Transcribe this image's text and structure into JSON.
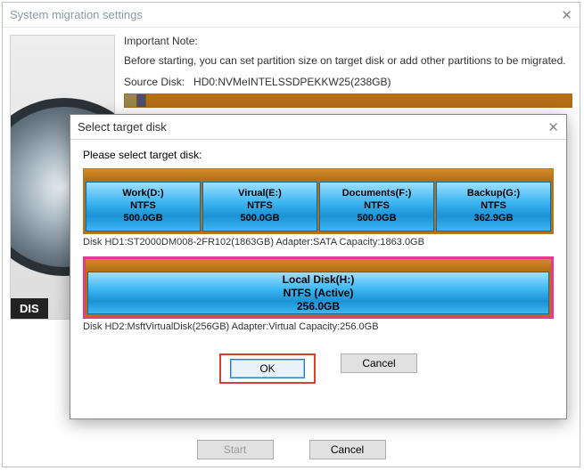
{
  "parent": {
    "title": "System migration settings",
    "illust_label": "DIS",
    "note_title": "Important Note:",
    "note_text": "Before starting, you can set partition size on target disk or add other partitions to be migrated.",
    "source_label": "Source Disk:",
    "source_value": "HD0:NVMeINTELSSDPEKKW25(238GB)",
    "start_label": "Start",
    "cancel_label": "Cancel"
  },
  "modal": {
    "title": "Select target disk",
    "prompt": "Please select target disk:",
    "disk1": {
      "parts": [
        {
          "name": "Work(D:)",
          "fs": "NTFS",
          "size": "500.0GB"
        },
        {
          "name": "Virual(E:)",
          "fs": "NTFS",
          "size": "500.0GB"
        },
        {
          "name": "Documents(F:)",
          "fs": "NTFS",
          "size": "500.0GB"
        },
        {
          "name": "Backup(G:)",
          "fs": "NTFS",
          "size": "362.9GB"
        }
      ],
      "meta": "Disk HD1:ST2000DM008-2FR102(1863GB)  Adapter:SATA  Capacity:1863.0GB"
    },
    "disk2": {
      "part": {
        "name": "Local Disk(H:)",
        "fs": "NTFS (Active)",
        "size": "256.0GB"
      },
      "meta": "Disk HD2:MsftVirtualDisk(256GB)  Adapter:Virtual  Capacity:256.0GB"
    },
    "ok_label": "OK",
    "cancel_label": "Cancel"
  }
}
